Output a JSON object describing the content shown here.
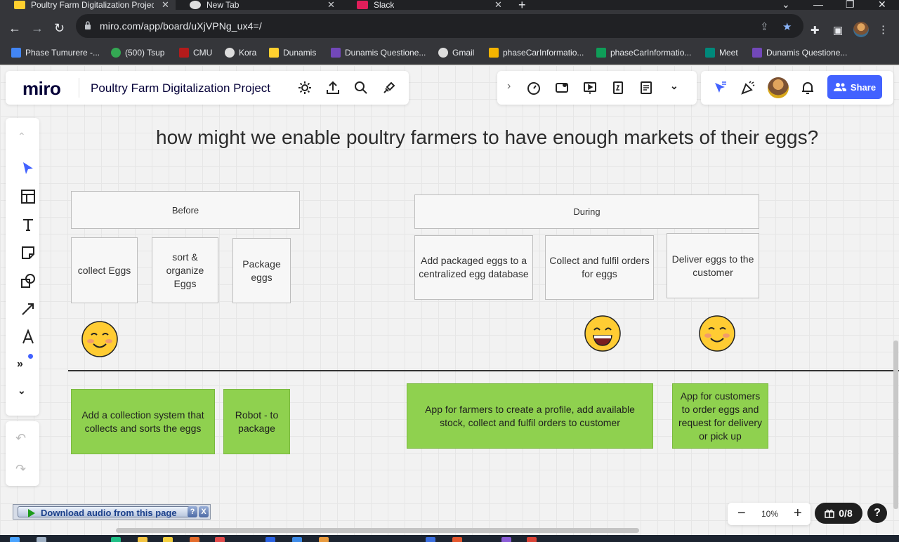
{
  "tabs": [
    {
      "title": "Poultry Farm Digitalization Projec",
      "active": true,
      "icon_color": "#ffd02f"
    },
    {
      "title": "New Tab",
      "active": false,
      "icon_color": "#dddddd"
    },
    {
      "title": "Slack",
      "active": false,
      "icon_color": "#e01e5a"
    }
  ],
  "address": {
    "url": "miro.com/app/board/uXjVPNg_ux4=/"
  },
  "bookmarks": [
    {
      "label": "Phase Tumurere -...",
      "color": "#4285f4"
    },
    {
      "label": "(500) Tsup",
      "color": "#34a853"
    },
    {
      "label": "CMU",
      "color": "#b31b1b"
    },
    {
      "label": "Kora",
      "color": "#dddddd"
    },
    {
      "label": "Dunamis",
      "color": "#ffd02f"
    },
    {
      "label": "Dunamis Questione...",
      "color": "#7248b9"
    },
    {
      "label": "Gmail",
      "color": "#dddddd"
    },
    {
      "label": "phaseCarInformatio...",
      "color": "#f4b400"
    },
    {
      "label": "phaseCarInformatio...",
      "color": "#0f9d58"
    },
    {
      "label": "Meet",
      "color": "#00897b"
    },
    {
      "label": "Dunamis Questione...",
      "color": "#7248b9"
    }
  ],
  "miro": {
    "logo": "miro",
    "board_title": "Poultry Farm Digitalization Project",
    "share_label": "Share",
    "zoom": "10%",
    "zoom_minus": "−",
    "zoom_plus": "+",
    "counter": "0/8",
    "help": "?"
  },
  "board": {
    "headline": "how might we enable poultry farmers to have enough markets of their eggs?",
    "frames": {
      "before": "Before",
      "during": "During"
    },
    "steps": [
      "collect Eggs",
      "sort & organize Eggs",
      "Package eggs",
      "Add packaged eggs to a centralized egg database",
      "Collect and fulfil orders for eggs",
      "Deliver eggs to the customer"
    ],
    "ideas": [
      "Add a collection system that collects and sorts the eggs",
      "Robot - to package",
      "App for farmers to create a profile, add available stock, collect and fulfil orders to customer",
      "App for customers to order eggs and request for delivery or pick up"
    ]
  },
  "download_bar": {
    "label": "Download audio from this page",
    "help": "?",
    "close": "X"
  },
  "colors": {
    "green_sticky": "#8fd14f",
    "share_blue": "#4262ff",
    "emoji_yellow": "#ffcc33"
  }
}
